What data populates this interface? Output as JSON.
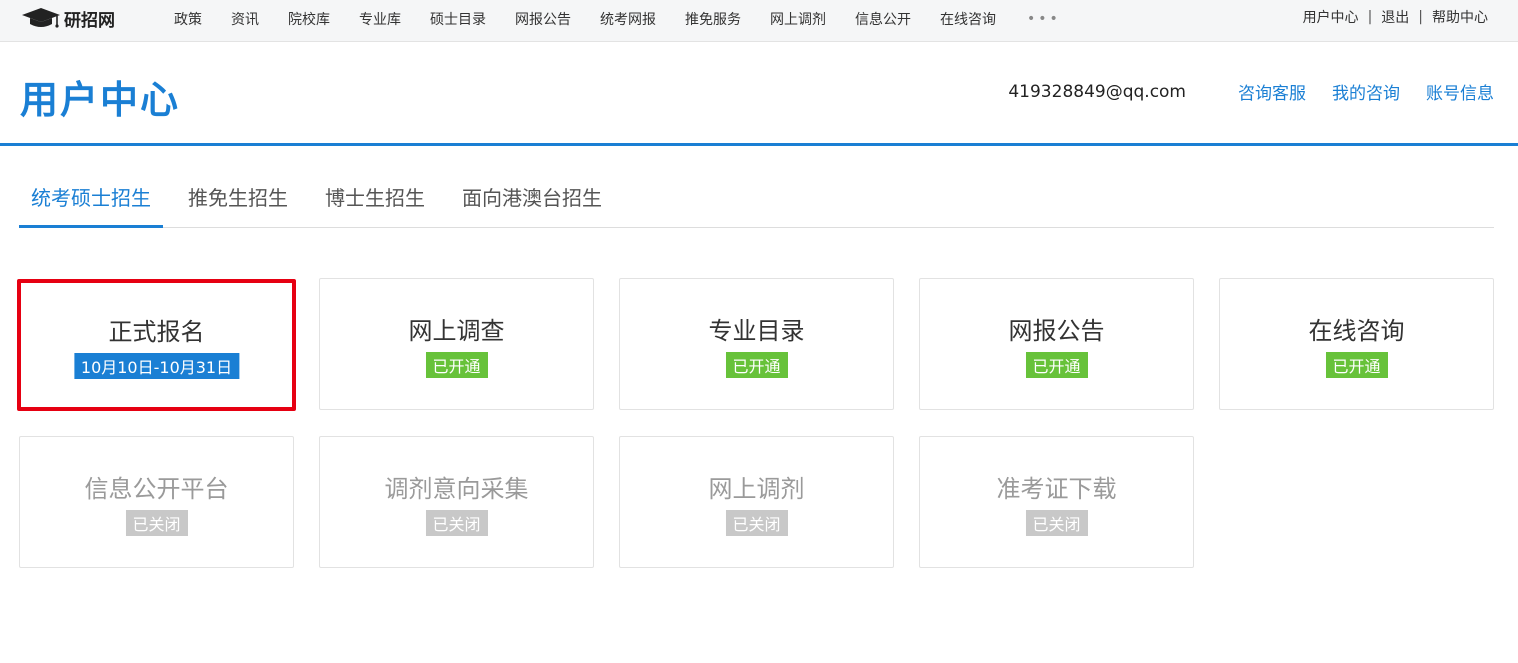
{
  "topbar": {
    "logo_text": "研招网",
    "nav": [
      "政策",
      "资讯",
      "院校库",
      "专业库",
      "硕士目录",
      "网报公告",
      "统考网报",
      "推免服务",
      "网上调剂",
      "信息公开",
      "在线咨询"
    ],
    "more": "•••",
    "right": {
      "user_center": "用户中心",
      "sep": "|",
      "logout": "退出",
      "help": "帮助中心"
    }
  },
  "header": {
    "title": "用户中心",
    "email": "419328849@qq.com",
    "links": [
      "咨询客服",
      "我的咨询",
      "账号信息"
    ]
  },
  "tabs": [
    {
      "label": "统考硕士招生",
      "active": true
    },
    {
      "label": "推免生招生",
      "active": false
    },
    {
      "label": "博士生招生",
      "active": false
    },
    {
      "label": "面向港澳台招生",
      "active": false
    }
  ],
  "cards": [
    {
      "title": "正式报名",
      "badge": "10月10日-10月31日",
      "status": "date",
      "highlight": true
    },
    {
      "title": "网上调查",
      "badge": "已开通",
      "status": "open"
    },
    {
      "title": "专业目录",
      "badge": "已开通",
      "status": "open"
    },
    {
      "title": "网报公告",
      "badge": "已开通",
      "status": "open"
    },
    {
      "title": "在线咨询",
      "badge": "已开通",
      "status": "open"
    },
    {
      "title": "信息公开平台",
      "badge": "已关闭",
      "status": "off"
    },
    {
      "title": "调剂意向采集",
      "badge": "已关闭",
      "status": "off"
    },
    {
      "title": "网上调剂",
      "badge": "已关闭",
      "status": "off"
    },
    {
      "title": "准考证下载",
      "badge": "已关闭",
      "status": "off"
    }
  ],
  "colors": {
    "accent": "#1a7fd4",
    "open": "#67c23a",
    "closed": "#c8c8c8",
    "highlight": "#e60012"
  },
  "icons": {
    "logo": "graduation-cap-icon"
  }
}
